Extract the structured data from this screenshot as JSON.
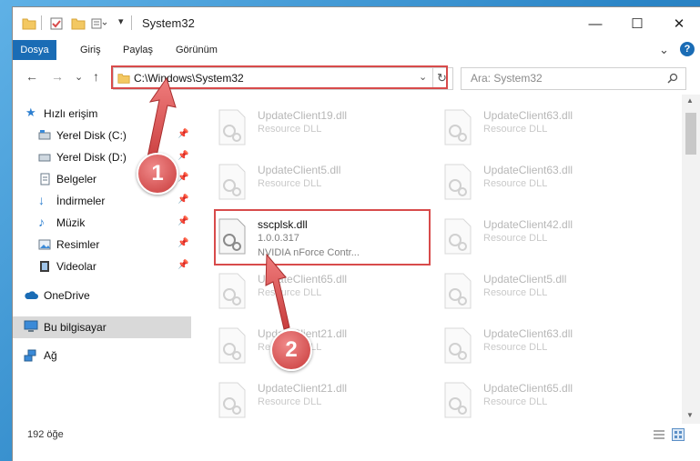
{
  "window": {
    "title": "System32",
    "controls": {
      "minimize": "—",
      "maximize": "☐",
      "close": "✕"
    }
  },
  "ribbon": {
    "tabs": [
      "Dosya",
      "Giriş",
      "Paylaş",
      "Görünüm"
    ],
    "right": {
      "chevron": "⌄",
      "help": "?"
    }
  },
  "nav": {
    "back": "←",
    "forward": "→",
    "recent": "⌄",
    "up": "↑",
    "address": "C:\\Windows\\System32",
    "search_placeholder": "Ara: System32"
  },
  "sidebar": {
    "quick_access": "Hızlı erişim",
    "items": [
      {
        "label": "Yerel Disk (C:)",
        "icon": "drive-icon"
      },
      {
        "label": "Yerel Disk (D:)",
        "icon": "drive-icon"
      },
      {
        "label": "Belgeler",
        "icon": "documents-icon"
      },
      {
        "label": "İndirmeler",
        "icon": "download-icon"
      },
      {
        "label": "Müzik",
        "icon": "music-icon"
      },
      {
        "label": "Resimler",
        "icon": "pictures-icon"
      },
      {
        "label": "Videolar",
        "icon": "video-icon"
      }
    ],
    "onedrive": "OneDrive",
    "this_pc": "Bu bilgisayar",
    "network": "Ağ"
  },
  "files": {
    "left": [
      {
        "name": "UpdateClient19.dll",
        "desc": "Resource DLL"
      },
      {
        "name": "UpdateClient5.dll",
        "desc": "Resource DLL"
      },
      {
        "name": "sscplsk.dll",
        "version": "1.0.0.317",
        "desc": "NVIDIA nForce Contr..."
      },
      {
        "name": "UpdateClient65.dll",
        "desc": "Resource DLL"
      },
      {
        "name": "UpdateClient21.dll",
        "desc": "Resource DLL"
      },
      {
        "name": "UpdateClient21.dll",
        "desc": "Resource DLL"
      }
    ],
    "right": [
      {
        "name": "UpdateClient63.dll",
        "desc": "Resource DLL"
      },
      {
        "name": "UpdateClient63.dll",
        "desc": "Resource DLL"
      },
      {
        "name": "UpdateClient42.dll",
        "desc": "Resource DLL"
      },
      {
        "name": "UpdateClient5.dll",
        "desc": "Resource DLL"
      },
      {
        "name": "UpdateClient63.dll",
        "desc": "Resource DLL"
      },
      {
        "name": "UpdateClient65.dll",
        "desc": "Resource DLL"
      }
    ]
  },
  "status": {
    "count": "192 öğe"
  },
  "annotations": {
    "step1": "1",
    "step2": "2"
  },
  "colors": {
    "accent": "#1a6cb5",
    "highlight": "#d84b4b",
    "selection": "#d9d9d9"
  }
}
